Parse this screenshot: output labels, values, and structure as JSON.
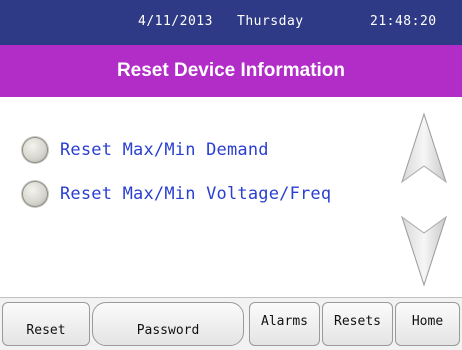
{
  "status_bar": {
    "date": "4/11/2013",
    "day": "Thursday",
    "time": "21:48:20"
  },
  "title": "Reset Device Information",
  "options": [
    {
      "label": "Reset Max/Min Demand"
    },
    {
      "label": "Reset Max/Min Voltage/Freq"
    }
  ],
  "nav": {
    "reset": "Reset",
    "password": "Password",
    "alarms": "Alarms",
    "resets": "Resets",
    "home": "Home"
  },
  "colors": {
    "status_bar": "#2f3a86",
    "title_bar": "#b22cc8",
    "option_text": "#2a3fd0"
  }
}
